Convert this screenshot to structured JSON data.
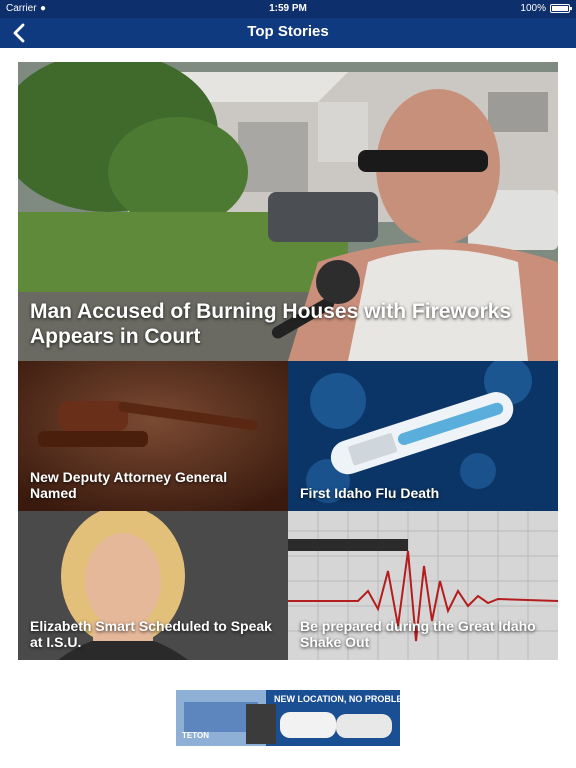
{
  "status": {
    "carrier": "Carrier",
    "time": "1:59 PM",
    "battery": "100%"
  },
  "nav": {
    "title": "Top Stories",
    "back_icon": "chevron-left-icon"
  },
  "stories": [
    {
      "title": "Man Accused of Burning Houses with Fireworks Appears in Court"
    },
    {
      "title": "New Deputy Attorney General Named"
    },
    {
      "title": "First Idaho Flu Death"
    },
    {
      "title": "Elizabeth Smart Scheduled to Speak at I.S.U."
    },
    {
      "title": "Be prepared during the Great Idaho Shake Out"
    }
  ],
  "ad": {
    "headline": "NEW LOCATION, NO PROBLEM.",
    "brand": "TETON"
  },
  "colors": {
    "navbar": "#0f3a80",
    "statusbar": "#0d2f6b"
  }
}
